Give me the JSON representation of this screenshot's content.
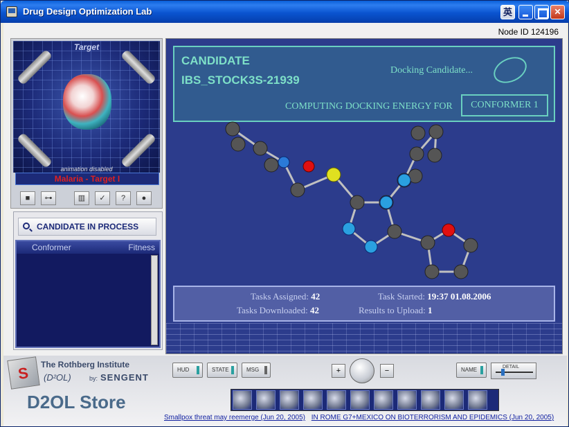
{
  "window": {
    "title": "Drug Design Optimization Lab",
    "ime_label": "英"
  },
  "node_id": "Node ID 124196",
  "target": {
    "title": "Target",
    "animation_note": "animation disabled",
    "label": "Malaria - Target I"
  },
  "candidate_panel": {
    "header": "CANDIDATE IN PROCESS",
    "columns": [
      "Conformer",
      "Fitness"
    ]
  },
  "hud": {
    "candidate_label": "CANDIDATE",
    "candidate_id": "IBS_STOCK3S-21939",
    "docking": "Docking Candidate...",
    "computing": "COMPUTING DOCKING ENERGY FOR",
    "conformer": "CONFORMER 1"
  },
  "stats": {
    "tasks_assigned_label": "Tasks Assigned:",
    "tasks_assigned": "42",
    "task_started_label": "Task Started:",
    "task_started": "19:37 01.08.2006",
    "tasks_downloaded_label": "Tasks Downloaded:",
    "tasks_downloaded": "42",
    "results_upload_label": "Results to Upload:",
    "results_upload": "1"
  },
  "brand": {
    "institute": "The Rothberg Institute",
    "d2ol": "(D²OL)",
    "by": "by:",
    "sengent": "SENGENT",
    "store": "D2OL Store"
  },
  "controls": {
    "hud": "HUD",
    "state": "STATE",
    "msg": "MSG",
    "name": "NAME",
    "detail": "DETAIL"
  },
  "ticker": [
    "Smallpox threat may reemerge  (Jun 20, 2005)",
    "IN ROME G7+MEXICO ON BIOTERRORISM AND EPIDEMICS  (Jun 20, 2005)"
  ],
  "colors": {
    "accent": "#7ee0c8",
    "panel_bg": "#2c3c8c",
    "target_label": "#e02020"
  }
}
